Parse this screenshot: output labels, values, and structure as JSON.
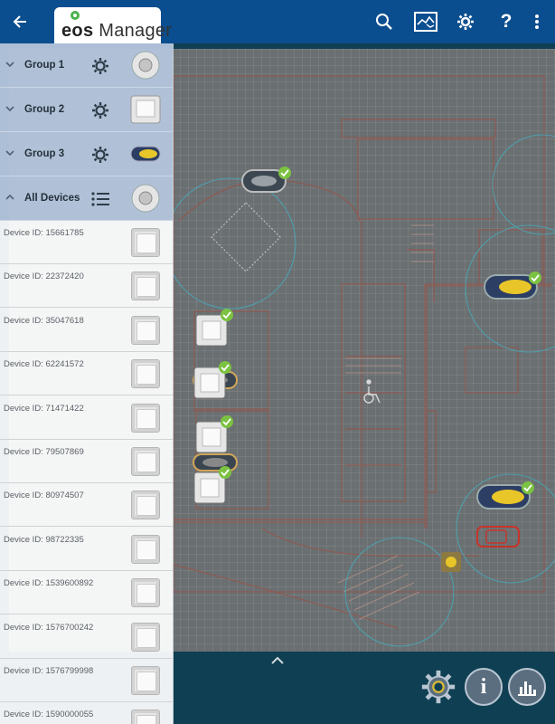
{
  "app": {
    "logo_word": "eos",
    "logo_suffix": "Manager"
  },
  "toolbar": {
    "back_icon": "arrow-left-icon",
    "search_icon": "search-icon",
    "map_icon": "map-icon",
    "settings_icon": "gear-icon",
    "help_label": "?",
    "overflow_icon": "more-vert-icon"
  },
  "groups": [
    {
      "label": "Group 1",
      "action_icon": "gear-icon",
      "thumb": "light-sensor"
    },
    {
      "label": "Group 2",
      "action_icon": "gear-icon",
      "thumb": "switch-panel"
    },
    {
      "label": "Group 3",
      "action_icon": "gear-icon",
      "thumb": "motion-sensor"
    },
    {
      "label": "All Devices",
      "action_icon": "list-icon",
      "thumb": "light-sensor"
    }
  ],
  "devices": [
    {
      "label": "Device ID: 15661785"
    },
    {
      "label": "Device ID: 22372420"
    },
    {
      "label": "Device ID: 35047618"
    },
    {
      "label": "Device ID: 62241572"
    },
    {
      "label": "Device ID: 71471422"
    },
    {
      "label": "Device ID: 79507869"
    },
    {
      "label": "Device ID: 80974507"
    },
    {
      "label": "Device ID: 98722335"
    },
    {
      "label": "Device ID: 1539600892"
    },
    {
      "label": "Device ID: 1576700242"
    },
    {
      "label": "Device ID: 1576799998"
    },
    {
      "label": "Device ID: 1590000055"
    }
  ],
  "bottom": {
    "expand_icon": "chevron-up-icon",
    "settings_icon": "gear-icon",
    "info_label": "i",
    "stats_icon": "bar-chart-icon"
  },
  "colors": {
    "appbar": "#0b4e8f",
    "map_bg": "#0f3f52",
    "check": "#7cc242"
  }
}
